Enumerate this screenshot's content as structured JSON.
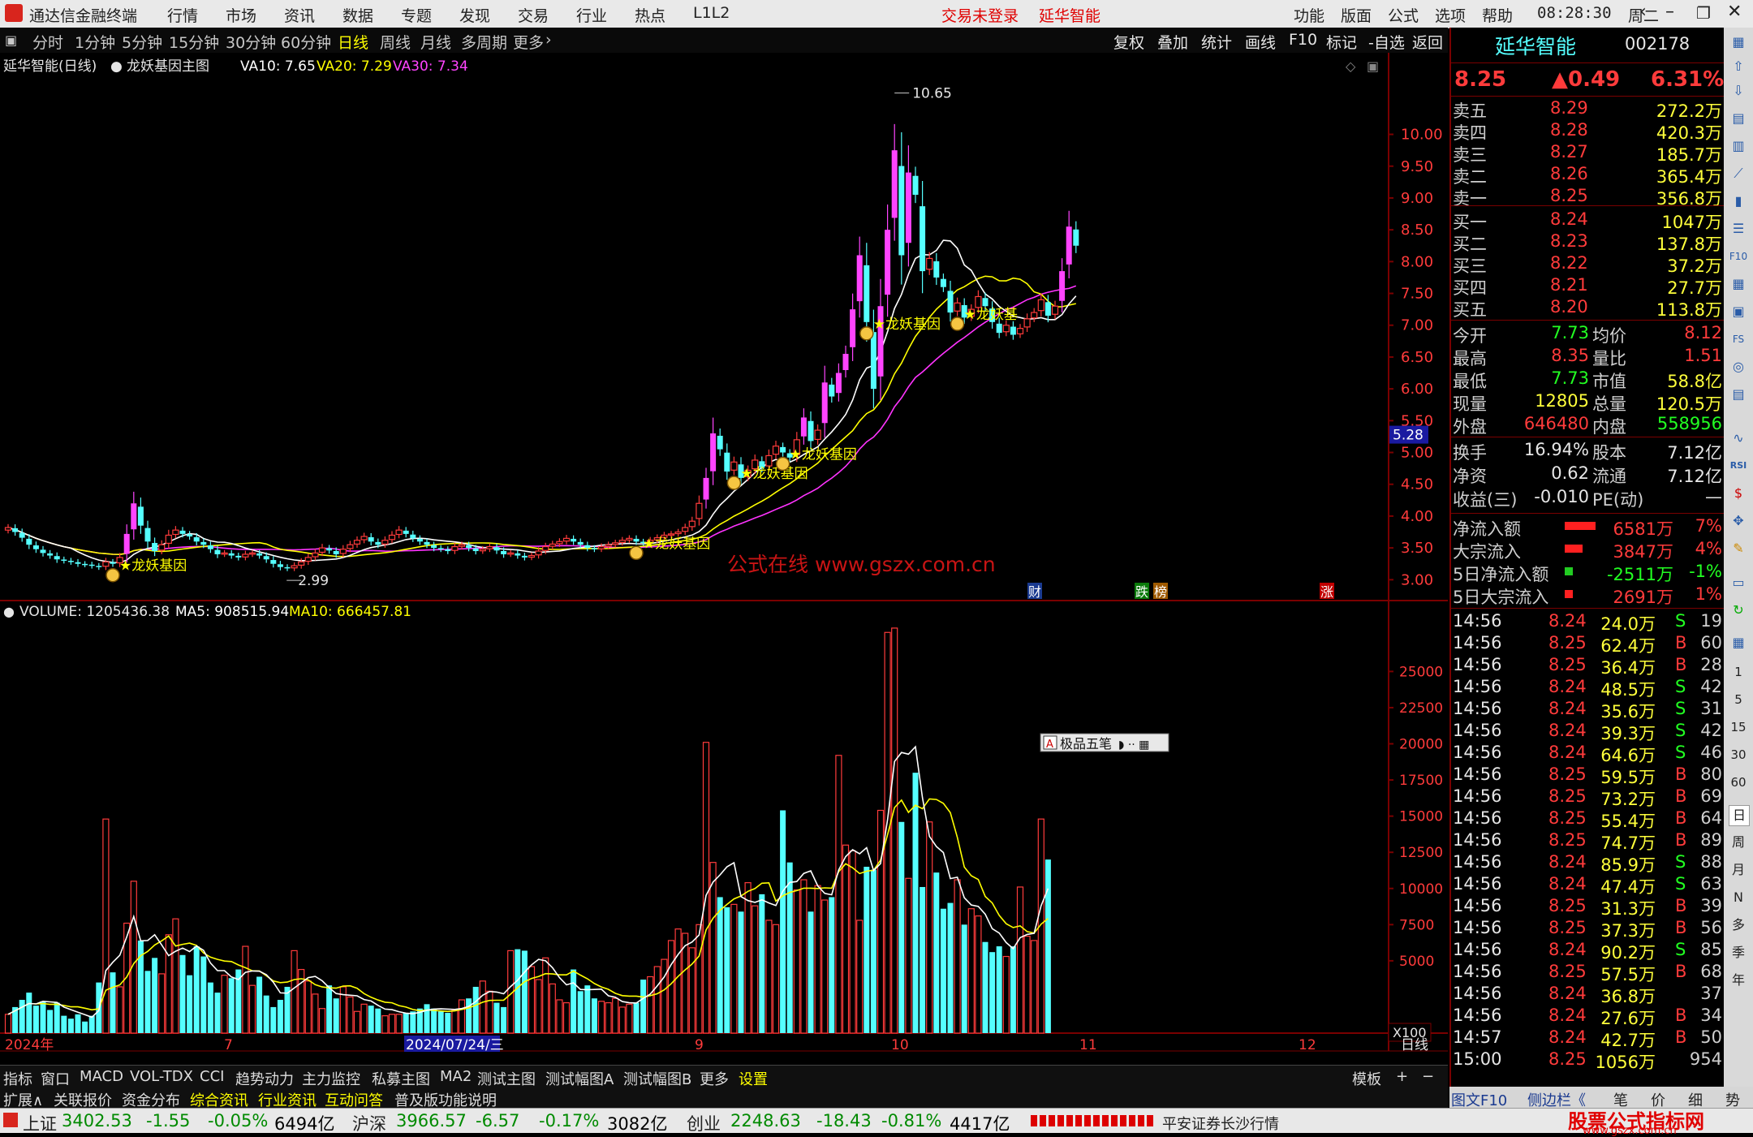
{
  "menubar": {
    "app_title": "通达信金融终端",
    "menus": [
      "行情",
      "市场",
      "资讯",
      "数据",
      "专题",
      "发现",
      "交易",
      "行业",
      "热点",
      "L1L2"
    ],
    "trade_status": "交易未登录",
    "stock_name": "延华智能",
    "right_menus": [
      "功能",
      "版面",
      "公式",
      "选项",
      "帮助"
    ],
    "clock": "08:28:30",
    "weekday": "周二"
  },
  "periodbar": {
    "periods": [
      "分时",
      "1分钟",
      "5分钟",
      "15分钟",
      "30分钟",
      "60分钟",
      "日线",
      "周线",
      "月线",
      "多周期",
      "更多"
    ],
    "selected": "日线",
    "tools": [
      "复权",
      "叠加",
      "统计",
      "画线",
      "F10",
      "标记",
      "-自选",
      "返回"
    ]
  },
  "chart_header": {
    "title": "延华智能(日线)",
    "formula": "龙妖基因主图",
    "va10": "VA10: 7.65",
    "va20": "VA20: 7.29",
    "va30": "VA30: 7.34"
  },
  "volume_header": {
    "volume": "VOLUME: 1205436.38",
    "ma5": "MA5: 908515.94",
    "ma10": "MA10: 666457.81"
  },
  "price_axis": [
    "10.00",
    "9.50",
    "9.00",
    "8.50",
    "8.00",
    "7.50",
    "7.00",
    "6.50",
    "6.00",
    "5.50",
    "5.00",
    "4.50",
    "4.00",
    "3.50",
    "3.00"
  ],
  "price_marker": "5.28",
  "high_label": "10.65",
  "low_label": "2.99",
  "signal_label": "★龙妖基因",
  "signal_label_short": "★龙妖基",
  "watermark": "公式在线  www.gszx.com.cn",
  "event_tags": [
    "财",
    "跌",
    "榜",
    "涨"
  ],
  "volume_axis": [
    "25000",
    "22500",
    "20000",
    "17500",
    "15000",
    "12500",
    "10000",
    "7500",
    "5000"
  ],
  "volume_scale": "X100",
  "xaxis": {
    "labels": [
      "2024年",
      "7",
      "2024/07/24/三",
      "9",
      "10",
      "11",
      "12"
    ],
    "right_label": "日线"
  },
  "popup": {
    "label": "极品五笔"
  },
  "chart_data": {
    "type": "candlestick",
    "title": "延华智能(日线)",
    "price_ylim": [
      2.8,
      10.9
    ],
    "close": [
      3.82,
      3.75,
      3.66,
      3.55,
      3.48,
      3.42,
      3.38,
      3.32,
      3.3,
      3.28,
      3.25,
      3.24,
      3.22,
      3.2,
      3.28,
      3.25,
      3.35,
      3.72,
      4.2,
      3.85,
      3.6,
      3.45,
      3.55,
      3.7,
      3.78,
      3.72,
      3.68,
      3.6,
      3.55,
      3.48,
      3.4,
      3.42,
      3.38,
      3.35,
      3.4,
      3.42,
      3.38,
      3.32,
      3.25,
      3.2,
      3.18,
      3.22,
      3.28,
      3.35,
      3.42,
      3.5,
      3.46,
      3.4,
      3.48,
      3.55,
      3.62,
      3.68,
      3.6,
      3.55,
      3.62,
      3.7,
      3.78,
      3.72,
      3.65,
      3.6,
      3.55,
      3.5,
      3.48,
      3.45,
      3.52,
      3.55,
      3.5,
      3.45,
      3.48,
      3.52,
      3.46,
      3.4,
      3.42,
      3.38,
      3.35,
      3.38,
      3.45,
      3.52,
      3.56,
      3.6,
      3.65,
      3.6,
      3.55,
      3.5,
      3.48,
      3.52,
      3.55,
      3.58,
      3.62,
      3.65,
      3.6,
      3.58,
      3.62,
      3.66,
      3.7,
      3.72,
      3.75,
      3.82,
      3.92,
      4.2,
      4.6,
      5.3,
      5.05,
      4.7,
      4.85,
      4.6,
      4.72,
      4.88,
      4.76,
      4.95,
      5.1,
      5.0,
      4.92,
      5.2,
      5.55,
      5.18,
      5.35,
      6.1,
      5.88,
      6.25,
      6.55,
      7.25,
      8.1,
      7.05,
      6.0,
      7.3,
      8.5,
      9.75,
      8.1,
      9.4,
      9.05,
      7.85,
      8.05,
      7.75,
      7.6,
      7.2,
      7.35,
      7.12,
      7.25,
      7.45,
      7.3,
      7.05,
      6.88,
      7.0,
      6.85,
      6.95,
      7.1,
      7.2,
      7.4,
      7.15,
      7.3,
      7.85,
      8.55,
      8.25
    ],
    "volume": [
      1300,
      1800,
      2300,
      2800,
      1900,
      2200,
      1600,
      2100,
      1200,
      1000,
      1300,
      800,
      1200,
      3500,
      14800,
      4200,
      3200,
      7600,
      10500,
      6400,
      4300,
      5200,
      4100,
      6800,
      7900,
      5400,
      4000,
      6000,
      5300,
      3500,
      2800,
      4000,
      3800,
      4400,
      6000,
      3300,
      3900,
      2600,
      1800,
      2300,
      3200,
      5700,
      4400,
      3600,
      2700,
      1700,
      3300,
      2400,
      3200,
      2500,
      1500,
      2000,
      1900,
      1700,
      1200,
      1300,
      1300,
      1400,
      1500,
      1700,
      2000,
      1700,
      1500,
      1400,
      1600,
      2300,
      2400,
      3200,
      3600,
      2900,
      2100,
      1800,
      5700,
      5800,
      5700,
      4600,
      3700,
      5200,
      3400,
      2300,
      2100,
      4400,
      2900,
      3300,
      2400,
      2200,
      2100,
      2400,
      1800,
      2000,
      2100,
      3700,
      3900,
      4600,
      5100,
      6400,
      7200,
      6900,
      5900,
      7500,
      20100,
      11800,
      9400,
      8700,
      8900,
      8400,
      10400,
      8800,
      9600,
      7800,
      7500,
      15400,
      11800,
      9900,
      10600,
      8400,
      10200,
      9200,
      9400,
      19200,
      13000,
      12600,
      7800,
      11500,
      11300,
      15400,
      27700,
      28000,
      14600,
      10700,
      18000,
      10100,
      14600,
      11100,
      8600,
      9000,
      10600,
      7500,
      8600,
      8100,
      6300,
      5600,
      6000,
      5300,
      6000,
      10100,
      6700,
      6400,
      14800,
      12000
    ],
    "vol_ylim": [
      0,
      28500
    ],
    "series": [
      {
        "name": "VA10",
        "value": 7.65
      },
      {
        "name": "VA20",
        "value": 7.29
      },
      {
        "name": "VA30",
        "value": 7.34
      }
    ]
  },
  "quote": {
    "name": "延华智能",
    "code": "002178",
    "price": "8.25",
    "change": "▲0.49",
    "pct": "6.31%",
    "asks": [
      {
        "label": "卖五",
        "price": "8.29",
        "vol": "272.2万"
      },
      {
        "label": "卖四",
        "price": "8.28",
        "vol": "420.3万"
      },
      {
        "label": "卖三",
        "price": "8.27",
        "vol": "185.7万"
      },
      {
        "label": "卖二",
        "price": "8.26",
        "vol": "365.4万"
      },
      {
        "label": "卖一",
        "price": "8.25",
        "vol": "356.8万"
      }
    ],
    "bids": [
      {
        "label": "买一",
        "price": "8.24",
        "vol": "1047万"
      },
      {
        "label": "买二",
        "price": "8.23",
        "vol": "137.8万"
      },
      {
        "label": "买三",
        "price": "8.22",
        "vol": "37.2万"
      },
      {
        "label": "买四",
        "price": "8.21",
        "vol": "27.7万"
      },
      {
        "label": "买五",
        "price": "8.20",
        "vol": "113.8万"
      }
    ],
    "stats1": [
      {
        "l1": "今开",
        "v1": "7.73",
        "l2": "均价",
        "v2": "8.12"
      },
      {
        "l1": "最高",
        "v1": "8.35",
        "l2": "量比",
        "v2": "1.51"
      },
      {
        "l1": "最低",
        "v1": "7.73",
        "l2": "市值",
        "v2": "58.8亿"
      },
      {
        "l1": "现量",
        "v1": "12805",
        "l2": "总量",
        "v2": "120.5万"
      },
      {
        "l1": "外盘",
        "v1": "646480",
        "l2": "内盘",
        "v2": "558956"
      }
    ],
    "stats2": [
      {
        "l1": "换手",
        "v1": "16.94%",
        "l2": "股本",
        "v2": "7.12亿"
      },
      {
        "l1": "净资",
        "v1": "0.62",
        "l2": "流通",
        "v2": "7.12亿"
      },
      {
        "l1": "收益(三)",
        "v1": "-0.010",
        "l2": "PE(动)",
        "v2": "—"
      }
    ],
    "flows": [
      {
        "label": "净流入额",
        "value": "6581万",
        "pct": "7%",
        "ratio": 1.0
      },
      {
        "label": "大宗流入",
        "value": "3847万",
        "pct": "4%",
        "ratio": 0.58
      },
      {
        "label": "5日净流入额",
        "value": "-2511万",
        "pct": "-1%",
        "ratio": 0.15
      },
      {
        "label": "5日大宗流入",
        "value": "2691万",
        "pct": "1%",
        "ratio": 0.25
      }
    ],
    "ticks": [
      {
        "t": "14:56",
        "p": "8.24",
        "v": "24.0万",
        "s": "S",
        "n": "19"
      },
      {
        "t": "14:56",
        "p": "8.25",
        "v": "62.4万",
        "s": "B",
        "n": "60"
      },
      {
        "t": "14:56",
        "p": "8.25",
        "v": "36.4万",
        "s": "B",
        "n": "28"
      },
      {
        "t": "14:56",
        "p": "8.24",
        "v": "48.5万",
        "s": "S",
        "n": "42"
      },
      {
        "t": "14:56",
        "p": "8.24",
        "v": "35.6万",
        "s": "S",
        "n": "31"
      },
      {
        "t": "14:56",
        "p": "8.24",
        "v": "39.3万",
        "s": "S",
        "n": "42"
      },
      {
        "t": "14:56",
        "p": "8.24",
        "v": "64.6万",
        "s": "S",
        "n": "46"
      },
      {
        "t": "14:56",
        "p": "8.25",
        "v": "59.5万",
        "s": "B",
        "n": "80"
      },
      {
        "t": "14:56",
        "p": "8.25",
        "v": "73.2万",
        "s": "B",
        "n": "69"
      },
      {
        "t": "14:56",
        "p": "8.25",
        "v": "55.4万",
        "s": "B",
        "n": "64"
      },
      {
        "t": "14:56",
        "p": "8.25",
        "v": "74.7万",
        "s": "B",
        "n": "89"
      },
      {
        "t": "14:56",
        "p": "8.24",
        "v": "85.9万",
        "s": "S",
        "n": "88"
      },
      {
        "t": "14:56",
        "p": "8.24",
        "v": "47.4万",
        "s": "S",
        "n": "63"
      },
      {
        "t": "14:56",
        "p": "8.25",
        "v": "31.3万",
        "s": "B",
        "n": "39"
      },
      {
        "t": "14:56",
        "p": "8.25",
        "v": "37.3万",
        "s": "B",
        "n": "56"
      },
      {
        "t": "14:56",
        "p": "8.24",
        "v": "90.2万",
        "s": "S",
        "n": "85"
      },
      {
        "t": "14:56",
        "p": "8.25",
        "v": "57.5万",
        "s": "B",
        "n": "68"
      },
      {
        "t": "14:56",
        "p": "8.24",
        "v": "36.8万",
        "s": "",
        "n": "37"
      },
      {
        "t": "14:56",
        "p": "8.24",
        "v": "27.6万",
        "s": "B",
        "n": "34"
      },
      {
        "t": "14:57",
        "p": "8.24",
        "v": "42.7万",
        "s": "B",
        "n": "50"
      },
      {
        "t": "15:00",
        "p": "8.25",
        "v": "1056万",
        "s": "",
        "n": "954"
      }
    ]
  },
  "iconcol": {
    "labels": [
      "RSI",
      "FS",
      "F10",
      "1",
      "5",
      "15",
      "30",
      "60",
      "日",
      "周",
      "月",
      "N",
      "多",
      "季",
      "年"
    ]
  },
  "tabs1": [
    "指标",
    "窗口",
    "MACD",
    "VOL-TDX",
    "CCI",
    "趋势动力",
    "主力监控",
    "私募主图",
    "MA2",
    "测试主图",
    "测试幅图A",
    "测试幅图B",
    "更多",
    "设置",
    "模板",
    "+",
    "−"
  ],
  "tabs1_active": "设置",
  "tabs2": [
    "扩展∧",
    "关联报价",
    "资金分布",
    "综合资讯",
    "行业资讯",
    "互动问答",
    "普及版功能说明"
  ],
  "rp_tabs": [
    "图文F10",
    "侧边栏《",
    "笔",
    "价",
    "细",
    "势"
  ],
  "status": {
    "sh_label": "上证",
    "sh_val": "3402.53",
    "sh_chg": "-1.55",
    "sh_pct": "-0.05%",
    "sh_amt": "6494亿",
    "hs_label": "沪深",
    "hs_val": "3966.57",
    "hs_chg": "-6.57",
    "hs_pct": "-0.17%",
    "hs_amt": "3082亿",
    "cy_label": "创业",
    "cy_val": "2248.63",
    "cy_chg": "-18.43",
    "cy_pct": "-0.81%",
    "cy_amt": "4417亿",
    "broker": "平安证券长沙行情",
    "brand1": "股票公式指标网",
    "brand2": "www.gszx.com.cn"
  },
  "colors": {
    "up": "#ff3b3b",
    "down": "#55ffff",
    "magenta": "#ff44ff",
    "ma_white": "#ffffff",
    "ma_yellow": "#ffff00",
    "ma_magenta": "#ff33ff",
    "axis_red": "#7a0000"
  }
}
